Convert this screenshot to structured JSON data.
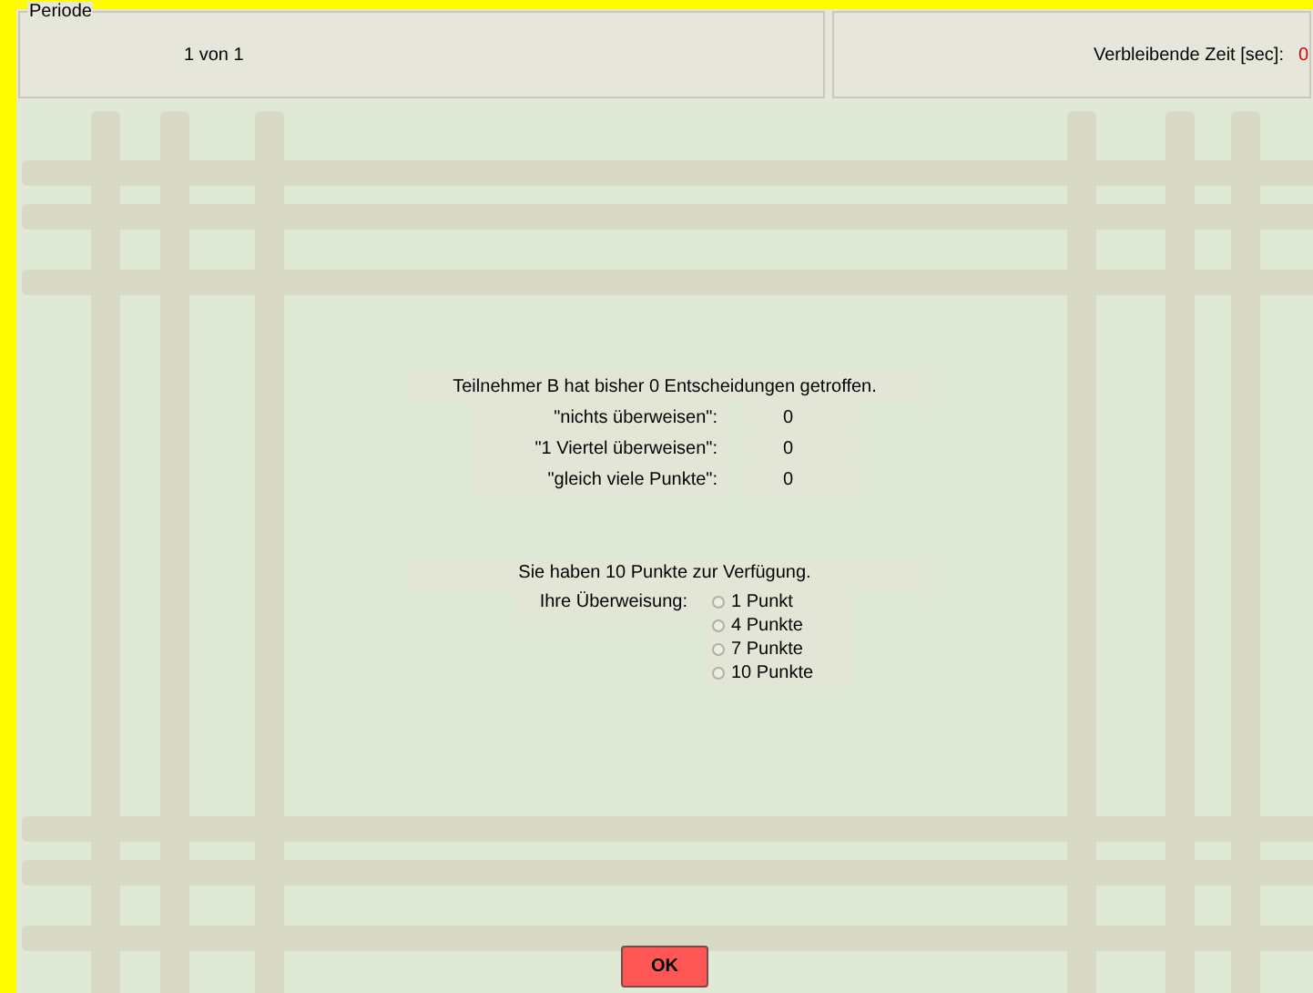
{
  "header": {
    "period_label": "Periode",
    "period_value": "1 von 1",
    "time_label": "Verbleibende Zeit [sec]:",
    "time_value": "0"
  },
  "summary": {
    "headline": "Teilnehmer B hat bisher 0 Entscheidungen getroffen.",
    "rows": [
      {
        "label": "\"nichts überweisen\":",
        "value": "0"
      },
      {
        "label": "\"1 Viertel überweisen\":",
        "value": "0"
      },
      {
        "label": "\"gleich viele Punkte\":",
        "value": "0"
      }
    ]
  },
  "transfer": {
    "headline": "Sie haben 10 Punkte zur Verfügung.",
    "label": "Ihre Überweisung:",
    "options": [
      {
        "label": "1 Punkt",
        "selected": false
      },
      {
        "label": "4 Punkte",
        "selected": false
      },
      {
        "label": "7 Punkte",
        "selected": false
      },
      {
        "label": "10 Punkte",
        "selected": false
      }
    ]
  },
  "ok_button": "OK"
}
